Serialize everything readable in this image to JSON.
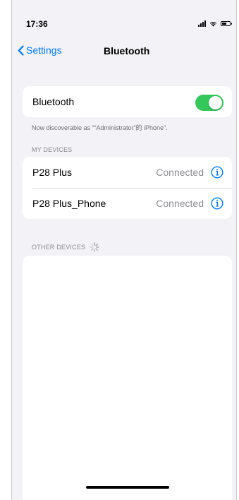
{
  "status_bar": {
    "time": "17:36"
  },
  "nav": {
    "back_label": "Settings",
    "title": "Bluetooth"
  },
  "bluetooth": {
    "label": "Bluetooth",
    "enabled": true,
    "discoverable_text": "Now discoverable as ““Administrator”的 iPhone”."
  },
  "my_devices": {
    "header": "MY DEVICES",
    "items": [
      {
        "name": "P28 Plus",
        "status": "Connected"
      },
      {
        "name": "P28 Plus_Phone",
        "status": "Connected"
      }
    ]
  },
  "other_devices": {
    "header": "OTHER DEVICES"
  },
  "colors": {
    "accent": "#007aff",
    "toggle_on": "#34c759",
    "background": "#f2f2f7"
  }
}
